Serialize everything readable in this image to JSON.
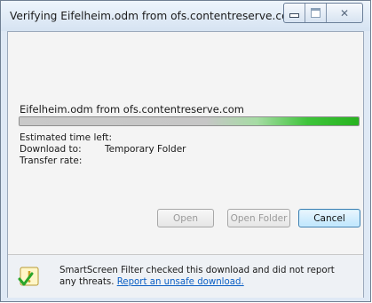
{
  "window": {
    "title": "Verifying Eifelheim.odm from ofs.contentreserve.com"
  },
  "download": {
    "file_label": "Eifelheim.odm from ofs.contentreserve.com",
    "progress_fraction": 1.0,
    "estimated_time_label": "Estimated time left:",
    "estimated_time_value": "",
    "download_to_label": "Download to:",
    "download_to_value": "Temporary Folder",
    "transfer_rate_label": "Transfer rate:",
    "transfer_rate_value": ""
  },
  "buttons": {
    "open": "Open",
    "open_folder": "Open Folder",
    "cancel": "Cancel"
  },
  "smartscreen": {
    "message": "SmartScreen Filter checked this download and did not report any threats.",
    "link": "Report an unsafe download."
  },
  "colors": {
    "progress_green": "#27b31f",
    "link_blue": "#0b5fc4",
    "window_frame": "#dfe9f5"
  },
  "icons": [
    "minimize-icon",
    "maximize-icon",
    "close-icon",
    "smartscreen-shield-icon"
  ]
}
